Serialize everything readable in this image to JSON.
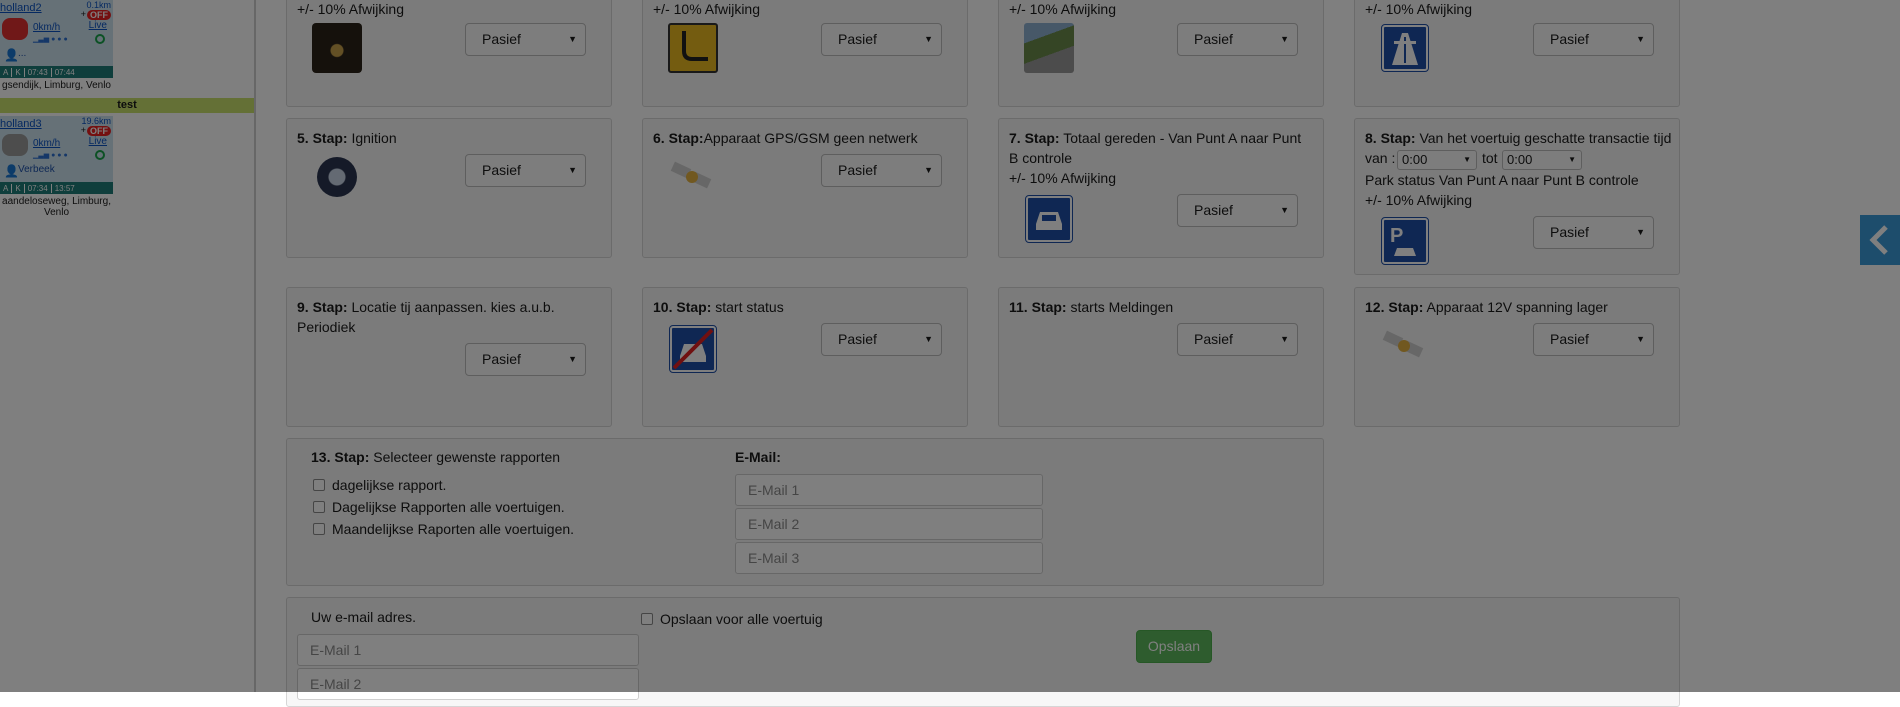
{
  "sidebar": {
    "vehicles": [
      {
        "name": "holland2",
        "distance": "0.1km",
        "plus": "+",
        "status_badge": "OFF",
        "speed": "0km/h",
        "live_label": "Live",
        "driver": "...",
        "footer": [
          "A",
          "K",
          "07:43",
          "07:44"
        ],
        "address": "gsendijk, Limburg, Venlo",
        "icon_color": "#e03030"
      },
      {
        "name": "holland3",
        "distance": "19.6km",
        "plus": "+",
        "status_badge": "OFF",
        "speed": "0km/h",
        "live_label": "Live",
        "driver": "Verbeek",
        "footer": [
          "A",
          "K",
          "07:34",
          "13:57"
        ],
        "address": "aandeloseweg, Limburg, Venlo",
        "icon_color": "#9a9a9a"
      }
    ],
    "group_label": "test"
  },
  "colors": {
    "accent_green": "#5cb85c",
    "sign_blue": "#1e4fa7",
    "group_bar": "#c8e06c",
    "collapse_tab": "#3a9ad9"
  },
  "steps": {
    "deviation_text": "+/- 10% Afwijking",
    "select_value": "Pasief",
    "row1": [
      {
        "icon": "speedometer-icon"
      },
      {
        "icon": "detour-sign-icon"
      },
      {
        "icon": "road-photo-icon"
      },
      {
        "icon": "highway-sign-icon"
      }
    ],
    "s5": {
      "num": "5. Stap:",
      "text": "Ignition",
      "icon": "ignition-key-icon"
    },
    "s6": {
      "num": "6. Stap:",
      "text": "Apparaat GPS/GSM geen netwerk",
      "icon": "satellite-icon"
    },
    "s7": {
      "num": "7. Stap:",
      "text": "Totaal gereden - Van Punt A naar Punt B controle",
      "icon": "car-sign-icon"
    },
    "s8": {
      "num": "8. Stap:",
      "text": "Van het voertuig geschatte transactie tijd",
      "van_label": "van :",
      "van_value": "0:00",
      "tot_label": "tot",
      "tot_value": "0:00",
      "park_text": "Park status Van Punt A naar Punt B controle",
      "icon": "parking-sign-icon"
    },
    "s9": {
      "num": "9. Stap:",
      "text": "Locatie tij aanpassen. kies a.u.b. Periodiek"
    },
    "s10": {
      "num": "10. Stap:",
      "text": "start status",
      "icon": "no-car-sign-icon"
    },
    "s11": {
      "num": "11. Stap:",
      "text": "starts Meldingen"
    },
    "s12": {
      "num": "12. Stap:",
      "text": "Apparaat 12V spanning lager",
      "icon": "satellite-icon"
    },
    "s13": {
      "num": "13. Stap:",
      "text": "Selecteer gewenste rapporten",
      "options": [
        "dagelijkse rapport.",
        "Dagelijkse Rapporten alle voertuigen.",
        "Maandelijkse Raporten alle voertuigen."
      ],
      "email_label": "E-Mail:",
      "email_placeholders": [
        "E-Mail 1",
        "E-Mail 2",
        "E-Mail 3"
      ]
    }
  },
  "footer_form": {
    "email_label": "Uw e-mail adres.",
    "email_placeholders": [
      "E-Mail 1",
      "E-Mail 2"
    ],
    "save_all_label": "Opslaan voor alle voertuig",
    "save_button": "Opslaan"
  }
}
